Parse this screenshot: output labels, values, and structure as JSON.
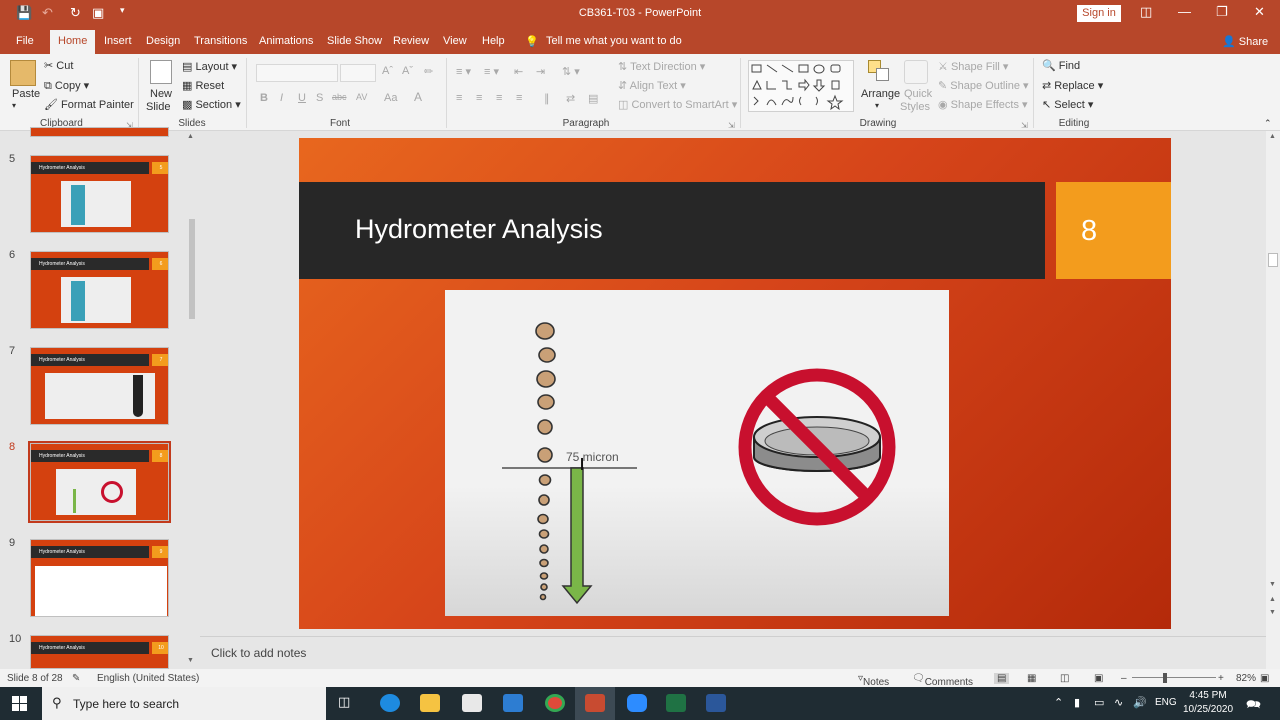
{
  "window": {
    "title": "CB361-T03  -  PowerPoint",
    "sign_in": "Sign in",
    "share": "Share"
  },
  "tabs": [
    "File",
    "Home",
    "Insert",
    "Design",
    "Transitions",
    "Animations",
    "Slide Show",
    "Review",
    "View",
    "Help"
  ],
  "tell_me": "Tell me what you want to do",
  "ribbon": {
    "clipboard": {
      "paste": "Paste",
      "cut": "Cut",
      "copy": "Copy",
      "format_painter": "Format Painter",
      "label": "Clipboard"
    },
    "slides": {
      "new_slide_1": "New",
      "new_slide_2": "Slide",
      "layout": "Layout",
      "reset": "Reset",
      "section": "Section",
      "label": "Slides"
    },
    "font": {
      "label": "Font",
      "buttons": [
        "B",
        "I",
        "U",
        "S",
        "abc",
        "AV",
        "Aa",
        "A"
      ]
    },
    "paragraph": {
      "text_direction": "Text Direction",
      "align_text": "Align Text",
      "convert": "Convert to SmartArt",
      "label": "Paragraph"
    },
    "drawing": {
      "arrange": "Arrange",
      "quick_1": "Quick",
      "quick_2": "Styles",
      "shape_fill": "Shape Fill",
      "shape_outline": "Shape Outline",
      "shape_effects": "Shape Effects",
      "label": "Drawing"
    },
    "editing": {
      "find": "Find",
      "replace": "Replace",
      "select": "Select",
      "label": "Editing"
    }
  },
  "thumbnails": [
    {
      "num": "5",
      "title": "Hydrometer Analysis",
      "badge": "5"
    },
    {
      "num": "6",
      "title": "Hydrometer Analysis",
      "badge": "6"
    },
    {
      "num": "7",
      "title": "Hydrometer Analysis",
      "badge": "7"
    },
    {
      "num": "8",
      "title": "Hydrometer Analysis",
      "badge": "8"
    },
    {
      "num": "9",
      "title": "Hydrometer Analysis",
      "badge": "9"
    },
    {
      "num": "10",
      "title": "Hydrometer Analysis",
      "badge": "10"
    }
  ],
  "slide": {
    "title": "Hydrometer Analysis",
    "number": "8",
    "label": "75 micron"
  },
  "notes_placeholder": "Click to add notes",
  "status": {
    "slide": "Slide 8 of 28",
    "language": "English (United States)",
    "notes": "Notes",
    "comments": "Comments",
    "zoom": "82%"
  },
  "taskbar": {
    "search": "Type here to search",
    "lang": "ENG",
    "time": "4:45 PM",
    "date": "10/25/2020"
  },
  "colors": {
    "accent": "#b7472a",
    "slide_orange": "#f39c1d",
    "slide_dark": "#272727",
    "green_arrow": "#7ab648",
    "no_symbol": "#c8102e"
  }
}
